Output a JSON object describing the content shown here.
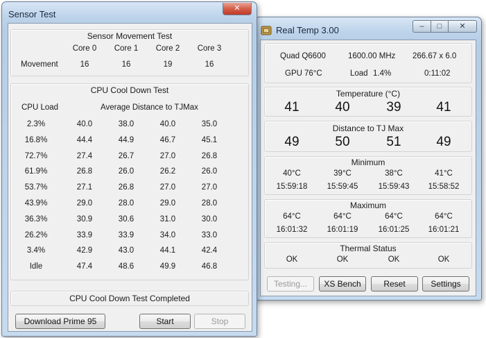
{
  "sensor_test": {
    "title": "Sensor Test",
    "movement_section": {
      "title": "Sensor Movement Test",
      "headers": [
        "Core 0",
        "Core 1",
        "Core 2",
        "Core 3"
      ],
      "row_label": "Movement",
      "values": [
        "16",
        "16",
        "19",
        "16"
      ]
    },
    "cooldown_section": {
      "title": "CPU Cool Down Test",
      "load_header": "CPU Load",
      "distance_header": "Average Distance to TJMax",
      "rows": [
        {
          "load": "2.3%",
          "values": [
            "40.0",
            "38.0",
            "40.0",
            "35.0"
          ]
        },
        {
          "load": "16.8%",
          "values": [
            "44.4",
            "44.9",
            "46.7",
            "45.1"
          ]
        },
        {
          "load": "72.7%",
          "values": [
            "27.4",
            "26.7",
            "27.0",
            "26.8"
          ]
        },
        {
          "load": "61.9%",
          "values": [
            "26.8",
            "26.0",
            "26.2",
            "26.0"
          ]
        },
        {
          "load": "53.7%",
          "values": [
            "27.1",
            "26.8",
            "27.0",
            "27.0"
          ]
        },
        {
          "load": "43.9%",
          "values": [
            "29.0",
            "28.0",
            "29.0",
            "28.0"
          ]
        },
        {
          "load": "36.3%",
          "values": [
            "30.9",
            "30.6",
            "31.0",
            "30.0"
          ]
        },
        {
          "load": "26.2%",
          "values": [
            "33.9",
            "33.9",
            "34.0",
            "33.0"
          ]
        },
        {
          "load": "3.4%",
          "values": [
            "42.9",
            "43.0",
            "44.1",
            "42.4"
          ]
        },
        {
          "load": "Idle",
          "values": [
            "47.4",
            "48.6",
            "49.9",
            "46.8"
          ]
        }
      ]
    },
    "status": "CPU Cool Down Test Completed",
    "buttons": {
      "download": "Download Prime 95",
      "start": "Start",
      "stop": "Stop"
    }
  },
  "real_temp": {
    "title": "Real Temp 3.00",
    "info": {
      "cpu": "Quad Q6600",
      "clock": "1600.00 MHz",
      "multiplier": "266.67 x 6.0",
      "gpu_label": "GPU",
      "gpu_temp": "76°C",
      "load_label": "Load",
      "load_value": "1.4%",
      "uptime": "0:11:02"
    },
    "temperature": {
      "title": "Temperature (°C)",
      "values": [
        "41",
        "40",
        "39",
        "41"
      ]
    },
    "distance": {
      "title": "Distance to TJ Max",
      "values": [
        "49",
        "50",
        "51",
        "49"
      ]
    },
    "minimum": {
      "title": "Minimum",
      "temps": [
        "40°C",
        "39°C",
        "38°C",
        "41°C"
      ],
      "times": [
        "15:59:18",
        "15:59:45",
        "15:59:43",
        "15:58:52"
      ]
    },
    "maximum": {
      "title": "Maximum",
      "temps": [
        "64°C",
        "64°C",
        "64°C",
        "64°C"
      ],
      "times": [
        "16:01:32",
        "16:01:19",
        "16:01:25",
        "16:01:21"
      ]
    },
    "thermal": {
      "title": "Thermal Status",
      "values": [
        "OK",
        "OK",
        "OK",
        "OK"
      ]
    },
    "buttons": {
      "testing": "Testing...",
      "xs_bench": "XS Bench",
      "reset": "Reset",
      "settings": "Settings"
    }
  },
  "icons": {
    "close": "✕",
    "minimize": "–",
    "maximize": "□"
  }
}
